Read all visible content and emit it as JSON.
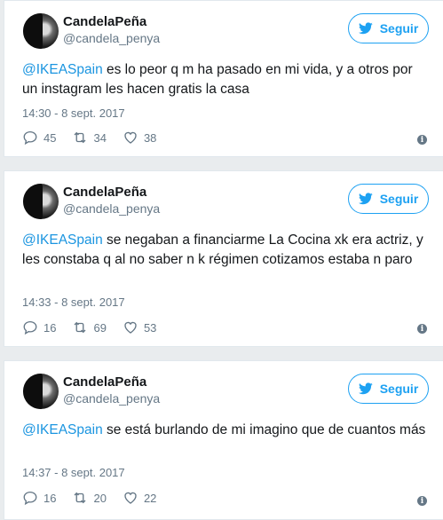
{
  "tweets": [
    {
      "name": "CandelaPeña",
      "handle": "@candela_penya",
      "follow_label": "Seguir",
      "mention": "@IKEASpain",
      "text": " es lo peor q m ha pasado en mi vida, y a otros por un instagram les hacen gratis la casa",
      "time": "14:30 - 8 sept. 2017",
      "replies": "45",
      "retweets": "34",
      "likes": "38",
      "info_icon": "i"
    },
    {
      "name": "CandelaPeña",
      "handle": "@candela_penya",
      "follow_label": "Seguir",
      "mention": "@IKEASpain",
      "text": " se negaban a financiarme La Cocina xk era actriz, y les constaba q al no saber n k régimen cotizamos estaba n paro",
      "time": "14:33 - 8 sept. 2017",
      "replies": "16",
      "retweets": "69",
      "likes": "53",
      "info_icon": "i"
    },
    {
      "name": "CandelaPeña",
      "handle": "@candela_penya",
      "follow_label": "Seguir",
      "mention": "@IKEASpain",
      "text": " se está burlando de mi imagino que de cuantos más",
      "time": "14:37 - 8 sept. 2017",
      "replies": "16",
      "retweets": "20",
      "likes": "22",
      "info_icon": "i"
    }
  ],
  "colors": {
    "accent": "#1da1f2",
    "mention": "#1b95e0",
    "muted": "#657786",
    "background": "#e9ecee"
  },
  "icons": [
    "twitter-bird-icon",
    "reply-icon",
    "retweet-icon",
    "like-heart-icon",
    "info-icon"
  ]
}
